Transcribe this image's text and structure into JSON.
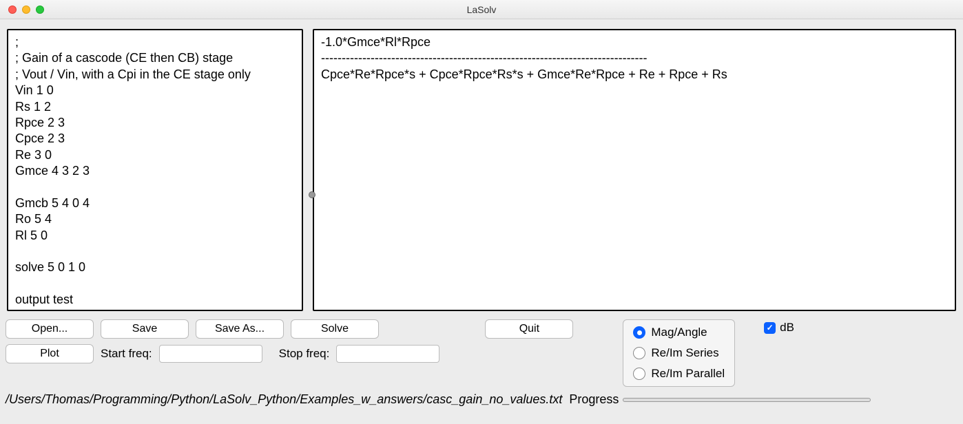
{
  "window": {
    "title": "LaSolv"
  },
  "editor": {
    "input_text": ";\n; Gain of a cascode (CE then CB) stage\n; Vout / Vin, with a Cpi in the CE stage only\nVin 1 0\nRs 1 2\nRpce 2 3\nCpce 2 3\nRe 3 0\nGmce 4 3 2 3\n\nGmcb 5 4 0 4\nRo 5 4\nRl 5 0\n\nsolve 5 0 1 0\n\noutput test",
    "output_text": "-1.0*Gmce*Rl*Rpce\n-------------------------------------------------------------------------------\nCpce*Re*Rpce*s + Cpce*Rpce*Rs*s + Gmce*Re*Rpce + Re + Rpce + Rs"
  },
  "buttons": {
    "open": "Open...",
    "save": "Save",
    "save_as": "Save As...",
    "solve": "Solve",
    "quit": "Quit",
    "plot": "Plot"
  },
  "freq": {
    "start_label": "Start freq:",
    "start_value": "",
    "stop_label": "Stop freq:",
    "stop_value": ""
  },
  "radio": {
    "options": {
      "mag_angle": "Mag/Angle",
      "reim_series": "Re/Im Series",
      "reim_parallel": "Re/Im Parallel"
    },
    "selected": "mag_angle"
  },
  "checkbox": {
    "db_label": "dB",
    "db_checked": true
  },
  "status": {
    "path": "/Users/Thomas/Programming/Python/LaSolv_Python/Examples_w_answers/casc_gain_no_values.txt",
    "progress_label": "Progress"
  }
}
